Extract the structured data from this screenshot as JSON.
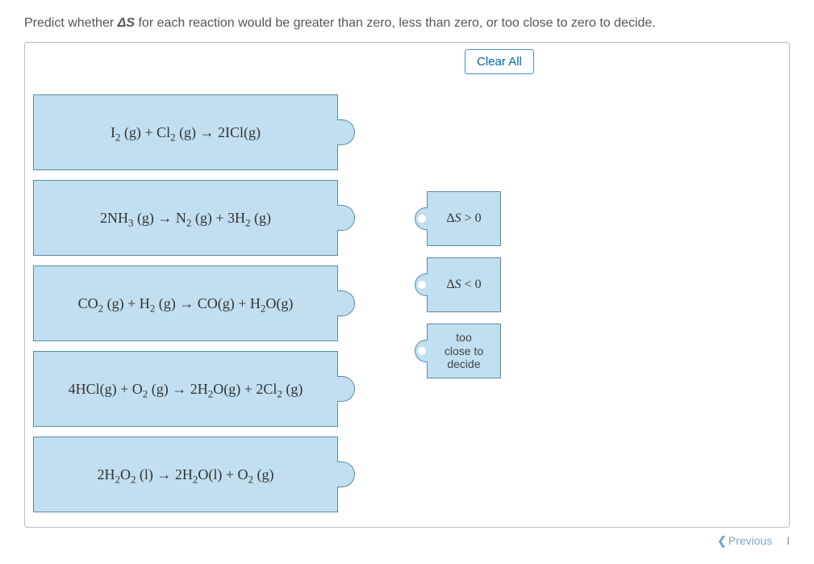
{
  "prompt": {
    "before": "Predict whether ",
    "symbol": "ΔS",
    "after": " for each reaction would be greater than zero, less than zero, or too close to zero to decide."
  },
  "clear_all_label": "Clear All",
  "reactions": [
    {
      "html": "I<span class='sub'>2</span> (g) + Cl<span class='sub'>2</span> (g) → 2ICl(g)"
    },
    {
      "html": "2NH<span class='sub'>3</span> (g) → N<span class='sub'>2</span> (g) + 3H<span class='sub'>2</span> (g)"
    },
    {
      "html": "CO<span class='sub'>2</span> (g) + H<span class='sub'>2</span> (g) → CO(g) + H<span class='sub'>2</span>O(g)"
    },
    {
      "html": "4HCl(g) + O<span class='sub'>2</span> (g) → 2H<span class='sub'>2</span>O(g) + 2Cl<span class='sub'>2</span> (g)"
    },
    {
      "html": "2H<span class='sub'>2</span>O<span class='sub'>2</span> (l) → 2H<span class='sub'>2</span>O(l) + O<span class='sub'>2</span> (g)"
    }
  ],
  "answers": [
    {
      "label_html": "Δ<i>S</i> > 0",
      "sans": false
    },
    {
      "label_html": "Δ<i>S</i> < 0",
      "sans": false
    },
    {
      "label_html": "too<br>close to<br>decide",
      "sans": true
    }
  ],
  "nav": {
    "previous": "Previous",
    "next_stub": "I"
  }
}
